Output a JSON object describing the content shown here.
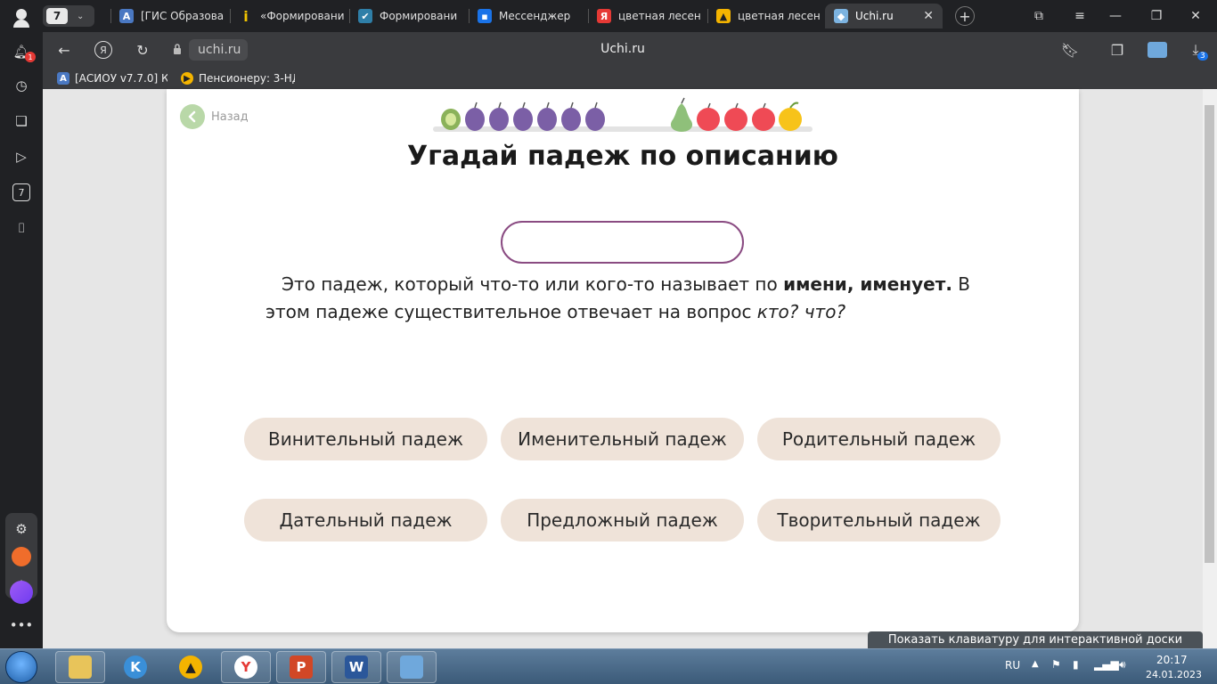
{
  "browser": {
    "tab_count": "7",
    "tabs": [
      {
        "label": "[ГИС Образова",
        "fav": "A",
        "color": "#4a78c2"
      },
      {
        "label": "«Формировани",
        "fav": "i",
        "color": "#f2c500"
      },
      {
        "label": "Формировани",
        "fav": "✔",
        "color": "#2f7fa8"
      },
      {
        "label": "Мессенджер",
        "fav": "▪",
        "color": "#1a73e8"
      },
      {
        "label": "цветная лесен",
        "fav": "Я",
        "color": "#e53935"
      },
      {
        "label": "цветная лесен",
        "fav": "▲",
        "color": "#f4b400"
      },
      {
        "label": "Uchi.ru",
        "fav": "◆",
        "color": "#7cb3e0"
      }
    ],
    "url": "uchi.ru",
    "page_title": "Uchi.ru",
    "bookmarks": [
      {
        "label": "[АСИОУ v7.7.0] Ка",
        "fav": "A",
        "color": "#4a78c2"
      },
      {
        "label": "Пенсионеру: 3-НД",
        "fav": "▶",
        "color": "#f4b400"
      }
    ],
    "notification_count": "1",
    "downloads_count": "3",
    "sidebar_num": "7"
  },
  "page": {
    "back_label": "Назад",
    "title": "Угадай падеж по описанию",
    "answer_value": "",
    "description": {
      "part1": "Это падеж, который что-то или кого-то называет по ",
      "bold": "имени, именует.",
      "part2": " В этом падеже существительное отвечает на вопрос ",
      "italic": "кто? что?"
    },
    "options": [
      "Винительный падеж",
      "Именительный падеж",
      "Родительный падеж",
      "Дательный падеж",
      "Предложный падеж",
      "Творительный падеж"
    ],
    "keyboard_hint": "Показать клавиатуру для интерактивной доски"
  },
  "colors": {
    "accent": "#8a4b82",
    "option_bg": "#efe3d9",
    "back_green": "#b9d8a8"
  },
  "taskbar": {
    "lang": "RU",
    "time": "20:17",
    "date": "24.01.2023"
  }
}
